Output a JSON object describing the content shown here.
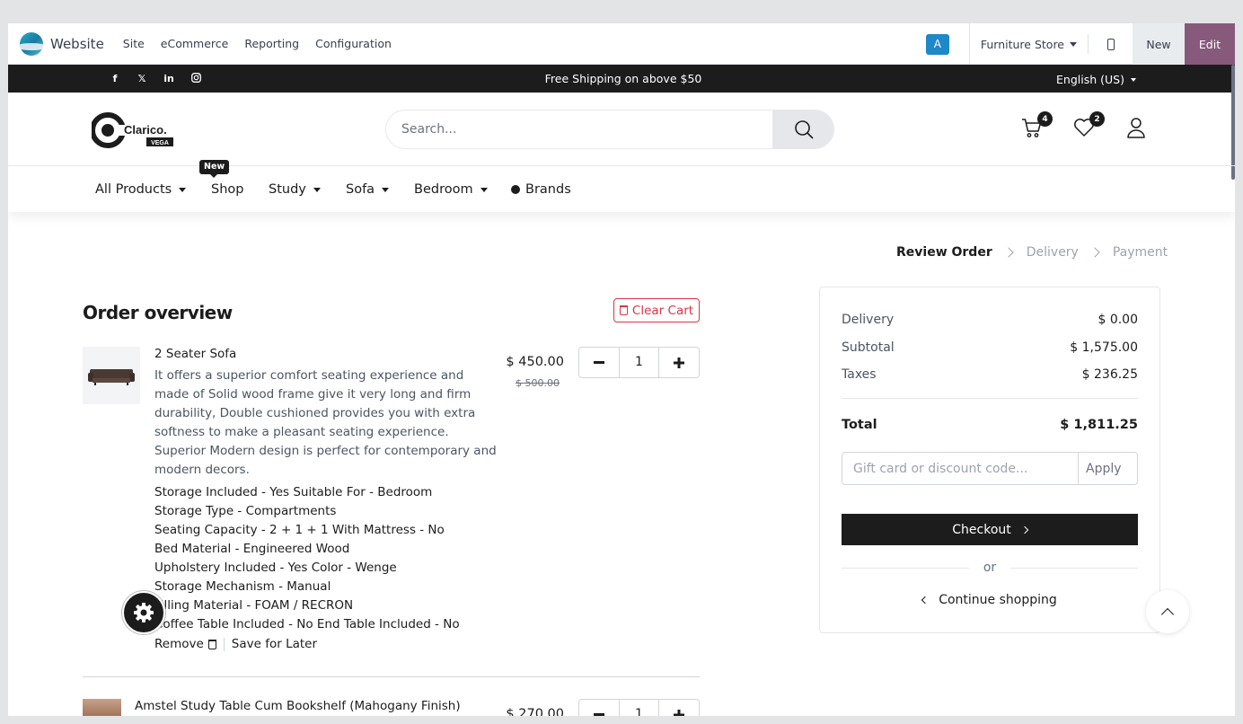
{
  "admin": {
    "app_name": "Website",
    "menu": [
      "Site",
      "eCommerce",
      "Reporting",
      "Configuration"
    ],
    "user_initial": "A",
    "store": "Furniture Store",
    "new_label": "New",
    "edit_label": "Edit",
    "accent": "#875a7b"
  },
  "topbar": {
    "social_icons": [
      "facebook-icon",
      "x-twitter-icon",
      "linkedin-icon",
      "instagram-icon"
    ],
    "promo": "Free Shipping on above $50",
    "language": "English (US)"
  },
  "header": {
    "logo_text": "Clarico.",
    "logo_sub": "VEGA",
    "search_placeholder": "Search...",
    "cart_count": "4",
    "wishlist_count": "2"
  },
  "nav": {
    "items": [
      "All Products",
      "Shop",
      "Study",
      "Sofa",
      "Bedroom",
      "Brands"
    ],
    "new_badge": "New"
  },
  "steps": [
    "Review Order",
    "Delivery",
    "Payment"
  ],
  "order": {
    "title": "Order overview",
    "clear_cart": "Clear Cart",
    "items": [
      {
        "name": "2 Seater Sofa",
        "description": "It offers a superior comfort seating experience and made of Solid wood frame give it very long and firm durability, Double cushioned provides you with extra softness to make a pleasant seating experience. Superior Modern design is perfect for contemporary and modern decors.",
        "attributes": [
          "Storage Included - Yes Suitable For - Bedroom",
          "Storage Type - Compartments",
          "Seating Capacity - 2 + 1 + 1 With Mattress - No",
          "Bed Material - Engineered Wood",
          "Upholstery Included - Yes Color - Wenge",
          "Storage Mechanism - Manual",
          "Filling Material - FOAM / RECRON",
          "Coffee Table Included - No End Table Included - No"
        ],
        "price": "$ 450.00",
        "old_price": "$ 500.00",
        "qty": "1",
        "remove": "Remove",
        "save_later": "Save for Later"
      },
      {
        "name": "Amstel Study Table Cum Bookshelf (Mahogany Finish)",
        "price": "$ 270.00",
        "qty": "1"
      }
    ]
  },
  "summary": {
    "delivery_label": "Delivery",
    "delivery": "$ 0.00",
    "subtotal_label": "Subtotal",
    "subtotal": "$ 1,575.00",
    "taxes_label": "Taxes",
    "taxes": "$ 236.25",
    "total_label": "Total",
    "total": "$ 1,811.25",
    "promo_placeholder": "Gift card or discount code...",
    "apply": "Apply",
    "checkout": "Checkout",
    "or": "or",
    "continue": "Continue shopping"
  }
}
